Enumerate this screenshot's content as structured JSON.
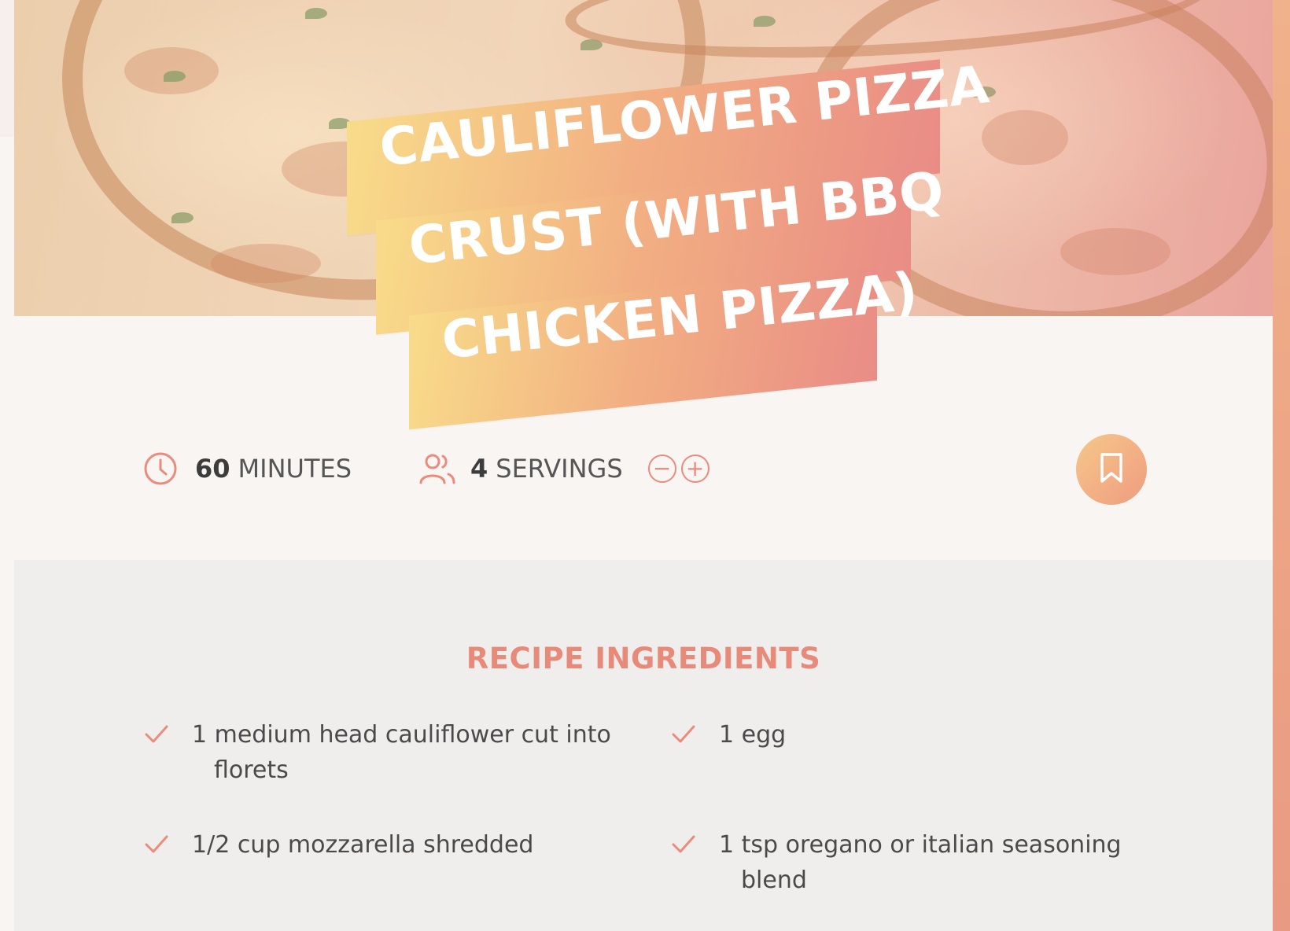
{
  "recipe": {
    "title_lines": [
      "CAULIFLOWER PIZZA",
      "CRUST (WITH BBQ",
      "CHICKEN PIZZA)"
    ],
    "time": {
      "value": "60",
      "unit": "MINUTES",
      "icon": "clock-icon"
    },
    "servings": {
      "value": "4",
      "unit": "SERVINGS",
      "icon": "users-icon",
      "decrease": "−",
      "increase": "+"
    },
    "bookmark_icon": "bookmark-icon"
  },
  "ingredients": {
    "heading": "RECIPE INGREDIENTS",
    "items": [
      "1 medium head cauliflower cut into florets",
      "1 egg",
      "1/2 cup mozzarella shredded",
      "1 tsp oregano or italian seasoning blend"
    ]
  },
  "colors": {
    "accent": "#e98c7c",
    "ribbon_start": "#f8dc8a",
    "ribbon_end": "#e98c86",
    "page_bg": "#f9f5f3",
    "section_bg": "#f0eeed"
  }
}
